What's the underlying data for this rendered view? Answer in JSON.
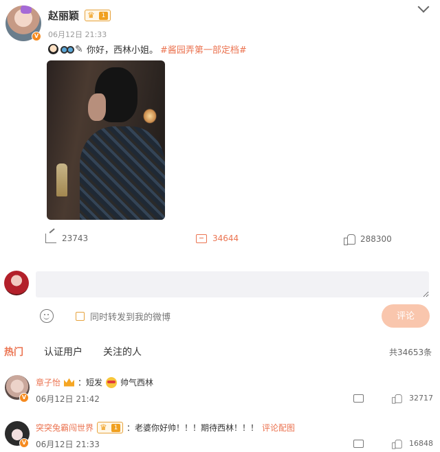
{
  "post": {
    "author": "赵丽颖",
    "vip_level": "1",
    "timestamp": "06月12日 21:33",
    "text": "你好，西林小姐。",
    "hashtag": "#酱园弄第一部定档#",
    "stats": {
      "reposts": "23743",
      "comments": "34644",
      "likes": "288300"
    }
  },
  "composer": {
    "placeholder": "",
    "repost_label": "同时转发到我的微博",
    "submit_label": "评论"
  },
  "tabs": {
    "hot": "热门",
    "verified": "认证用户",
    "following": "关注的人"
  },
  "total_label": "共34653条",
  "comments": [
    {
      "name": "章子怡",
      "text_a": "：短发",
      "text_b": "帅气西林",
      "time": "06月12日 21:42",
      "likes": "32717"
    },
    {
      "name": "突突兔霸闯世界",
      "vip_level": "1",
      "text": "：老婆你好帅！！！期待西林！！！",
      "link": "评论配图",
      "time": "06月12日 21:33",
      "likes": "16848"
    }
  ],
  "colors": {
    "accent": "#eb7350",
    "vip": "#f0a020"
  }
}
